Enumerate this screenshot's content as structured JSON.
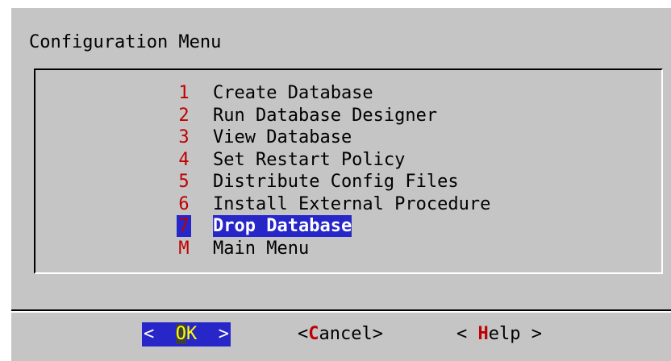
{
  "dialog": {
    "title": "Configuration Menu"
  },
  "menu": {
    "items": [
      {
        "key": "1",
        "label": "Create Database",
        "selected": false
      },
      {
        "key": "2",
        "label": "Run Database Designer",
        "selected": false
      },
      {
        "key": "3",
        "label": "View Database",
        "selected": false
      },
      {
        "key": "4",
        "label": "Set Restart Policy",
        "selected": false
      },
      {
        "key": "5",
        "label": "Distribute Config Files",
        "selected": false
      },
      {
        "key": "6",
        "label": "Install External Procedure",
        "selected": false
      },
      {
        "key": "7",
        "label": "Drop Database",
        "selected": true
      },
      {
        "key": "M",
        "label": "Main Menu",
        "selected": false
      }
    ]
  },
  "buttons": {
    "ok": {
      "left": "<",
      "hot": "O",
      "rest": "K",
      "right": ">"
    },
    "cancel": {
      "left": "<",
      "hot": "C",
      "rest": "ancel",
      "right": ">"
    },
    "help": {
      "left": "< ",
      "hot": "H",
      "rest": "elp",
      "right": " >"
    }
  },
  "colors": {
    "dialog_bg": "#c5c5c5",
    "highlight_bg": "#2727c9",
    "hotkey": "#c00000",
    "ok_hotkey": "#ffff00"
  }
}
